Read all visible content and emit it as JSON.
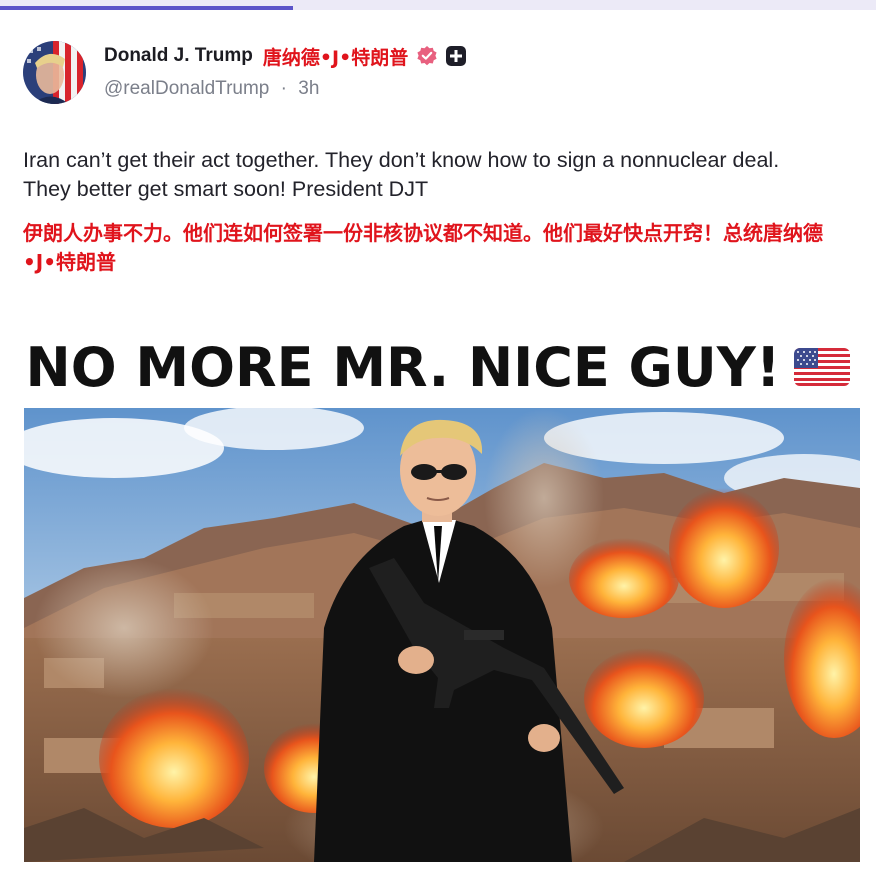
{
  "progress": {
    "fraction": 0.335,
    "color": "#5b54c9"
  },
  "author": {
    "display_name": "Donald J. Trump",
    "cn_name": "唐纳德•J•特朗普",
    "handle": "@realDonaldTrump",
    "separator": "·",
    "time_ago": "3h",
    "verified_icon": "verified-badge-icon",
    "extra_badge_icon": "plus-badge-icon"
  },
  "post": {
    "text": "Iran can’t get their act together. They don’t know how to sign a nonnuclear deal. They better get smart soon! President DJT",
    "translation": "伊朗人办事不力。他们连如何签署一份非核协议都不知道。他们最好快点开窍！总统唐纳德•J•特朗普"
  },
  "image": {
    "headline": "NO MORE MR. NICE GUY!",
    "flag_icon": "us-flag-icon"
  },
  "colors": {
    "accent": "#5b54c9",
    "translation_red": "#e0141c",
    "verified_pink": "#e8607f",
    "handle_gray": "#7b7f8a"
  }
}
